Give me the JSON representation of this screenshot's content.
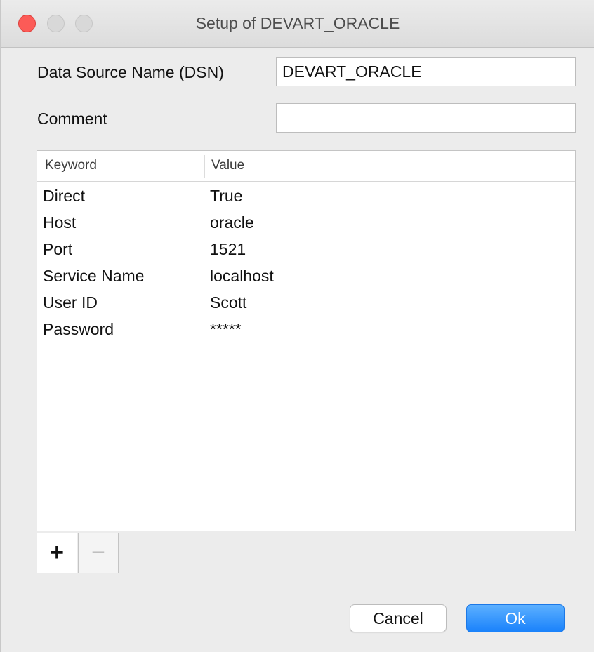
{
  "window": {
    "title": "Setup of DEVART_ORACLE"
  },
  "form": {
    "dsn_label": "Data Source Name (DSN)",
    "dsn_value": "DEVART_ORACLE",
    "comment_label": "Comment",
    "comment_value": ""
  },
  "table": {
    "columns": [
      "Keyword",
      "Value"
    ],
    "rows": [
      {
        "keyword": "Direct",
        "value": "True"
      },
      {
        "keyword": "Host",
        "value": "oracle"
      },
      {
        "keyword": "Port",
        "value": "1521"
      },
      {
        "keyword": "Service Name",
        "value": "localhost"
      },
      {
        "keyword": "User ID",
        "value": "Scott"
      },
      {
        "keyword": "Password",
        "value": "*****"
      }
    ]
  },
  "toolbar": {
    "add_label": "+",
    "remove_label": "−"
  },
  "buttons": {
    "cancel_label": "Cancel",
    "ok_label": "Ok"
  },
  "colors": {
    "close_button": "#fc5b57",
    "default_button": "#1a82fb"
  }
}
